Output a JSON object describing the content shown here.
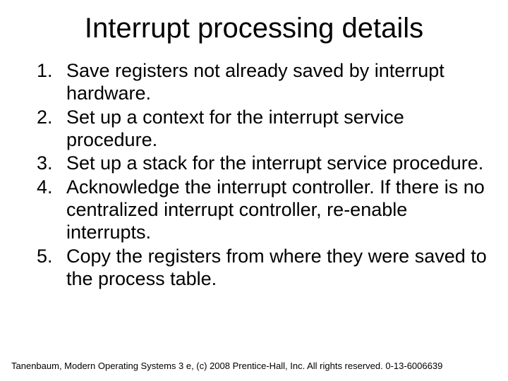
{
  "title": "Interrupt processing details",
  "items": [
    "Save registers not already saved by interrupt hardware.",
    "Set up a context for the interrupt service procedure.",
    "Set up a stack for the interrupt service procedure.",
    "Acknowledge the interrupt controller. If there is no centralized interrupt controller, re-enable interrupts.",
    "Copy the registers from where they were saved to the process table."
  ],
  "footer": "Tanenbaum, Modern Operating Systems 3 e, (c) 2008 Prentice-Hall, Inc. All rights reserved. 0-13-6006639"
}
